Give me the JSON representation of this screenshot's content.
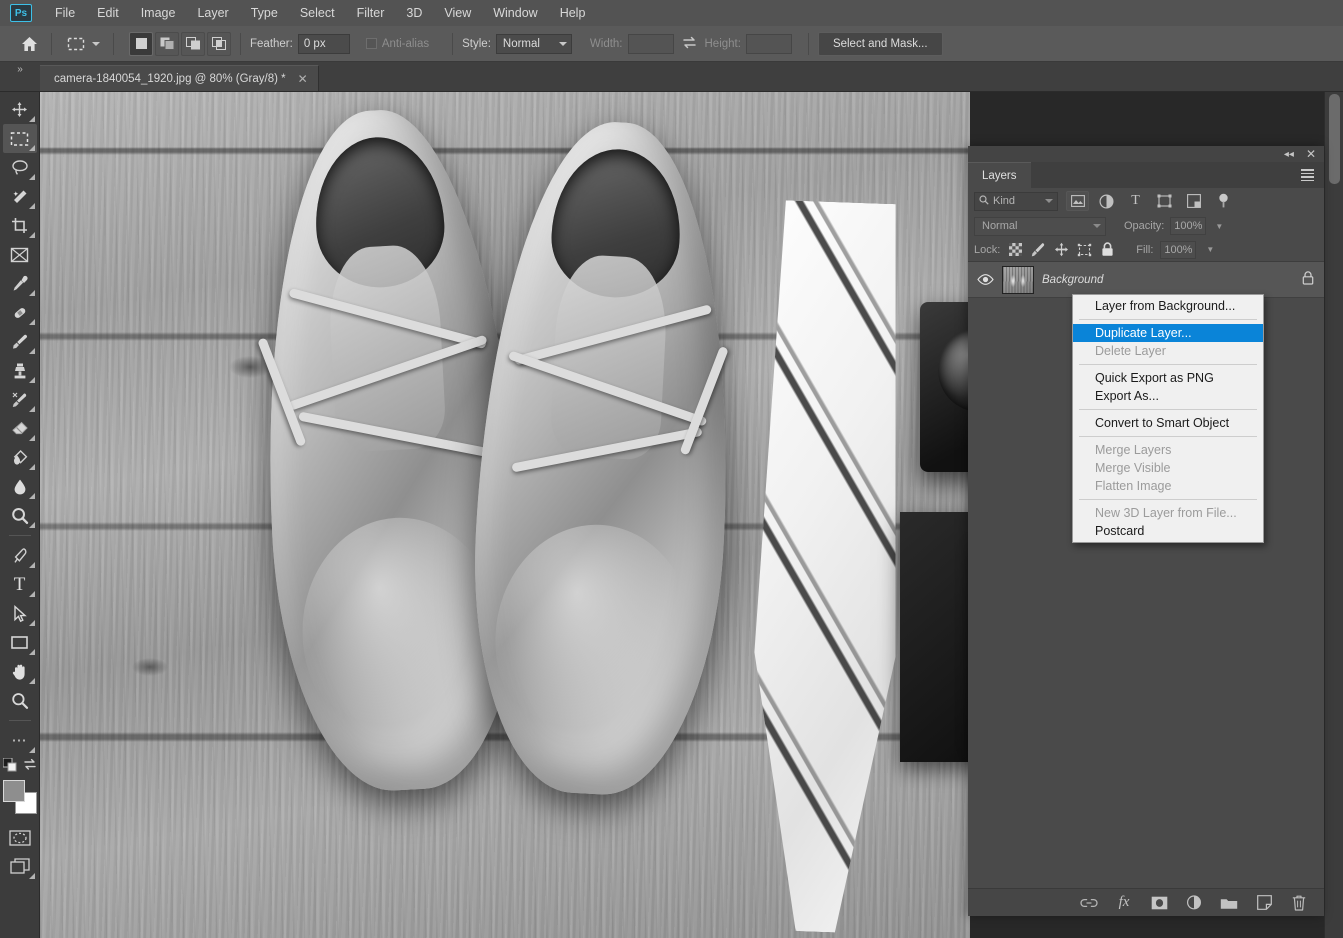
{
  "app": {
    "logo": "Ps"
  },
  "menubar": {
    "items": [
      "File",
      "Edit",
      "Image",
      "Layer",
      "Type",
      "Select",
      "Filter",
      "3D",
      "View",
      "Window",
      "Help"
    ]
  },
  "optionsbar": {
    "home_icon": "home-icon",
    "tool_preset_icon": "marquee-tool-icon",
    "selection_modes": [
      {
        "name": "new-selection",
        "active": true
      },
      {
        "name": "add-to-selection",
        "active": false
      },
      {
        "name": "subtract-from-selection",
        "active": false
      },
      {
        "name": "intersect-with-selection",
        "active": false
      }
    ],
    "feather_label": "Feather:",
    "feather_value": "0 px",
    "antialias_label": "Anti-alias",
    "antialias_checked": false,
    "style_label": "Style:",
    "style_value": "Normal",
    "width_label": "Width:",
    "width_value": "",
    "swap_icon": "swap-width-height-icon",
    "height_label": "Height:",
    "height_value": "",
    "select_and_mask_label": "Select and Mask..."
  },
  "tabbar": {
    "collapse_icon": "expand-panels-icon",
    "document_title": "camera-1840054_1920.jpg @ 80% (Gray/8) *",
    "close_icon": "close-icon"
  },
  "toolbar": {
    "tools": [
      {
        "name": "move-tool",
        "glyph": "✥",
        "active": false,
        "has_flyout": true
      },
      {
        "name": "rectangular-marquee-tool",
        "glyph": "",
        "active": true,
        "has_flyout": true
      },
      {
        "name": "lasso-tool",
        "glyph": "",
        "active": false,
        "has_flyout": true
      },
      {
        "name": "magic-wand-tool",
        "glyph": "",
        "active": false,
        "has_flyout": true
      },
      {
        "name": "crop-tool",
        "glyph": "",
        "active": false,
        "has_flyout": true
      },
      {
        "name": "frame-tool",
        "glyph": "",
        "active": false,
        "has_flyout": false
      },
      {
        "name": "eyedropper-tool",
        "glyph": "",
        "active": false,
        "has_flyout": true
      },
      {
        "name": "spot-healing-brush-tool",
        "glyph": "",
        "active": false,
        "has_flyout": true
      },
      {
        "name": "brush-tool",
        "glyph": "",
        "active": false,
        "has_flyout": true
      },
      {
        "name": "clone-stamp-tool",
        "glyph": "",
        "active": false,
        "has_flyout": true
      },
      {
        "name": "history-brush-tool",
        "glyph": "",
        "active": false,
        "has_flyout": true
      },
      {
        "name": "eraser-tool",
        "glyph": "",
        "active": false,
        "has_flyout": true
      },
      {
        "name": "gradient-tool",
        "glyph": "",
        "active": false,
        "has_flyout": true
      },
      {
        "name": "blur-tool",
        "glyph": "",
        "active": false,
        "has_flyout": true
      },
      {
        "name": "dodge-tool",
        "glyph": "",
        "active": false,
        "has_flyout": true
      },
      {
        "name": "pen-tool",
        "glyph": "",
        "active": false,
        "has_flyout": true
      },
      {
        "name": "horizontal-type-tool",
        "glyph": "T",
        "active": false,
        "has_flyout": true
      },
      {
        "name": "path-selection-tool",
        "glyph": "",
        "active": false,
        "has_flyout": true
      },
      {
        "name": "rectangle-tool",
        "glyph": "",
        "active": false,
        "has_flyout": true
      },
      {
        "name": "hand-tool",
        "glyph": "",
        "active": false,
        "has_flyout": true
      },
      {
        "name": "zoom-tool",
        "glyph": "",
        "active": false,
        "has_flyout": false
      },
      {
        "name": "edit-toolbar-button",
        "glyph": "⋯",
        "active": false,
        "has_flyout": true
      }
    ],
    "default_colors_icon": "default-colors-icon",
    "swap_colors_icon": "swap-colors-icon",
    "foreground_color": "#8e8e8e",
    "background_color": "#ffffff",
    "quick_mask_icon": "quick-mask-mode-icon",
    "screen_mode_icon": "screen-mode-icon"
  },
  "canvas": {
    "image_description": "Grayscale photo of a pair of brogue shoes, a striped necktie, a camera and a notebook on weathered wooden planks"
  },
  "layers_panel": {
    "collapse_icon": "collapse-panel-icon",
    "close_icon": "close-panel-icon",
    "tab_label": "Layers",
    "menu_icon": "panel-menu-icon",
    "filter": {
      "search_icon": "search-icon",
      "kind_label": "Kind",
      "icons": [
        "pixel-layers-filter-icon",
        "adjustment-layers-filter-icon",
        "type-layers-filter-icon",
        "shape-layers-filter-icon",
        "smart-object-filter-icon",
        "filter-toggle-icon"
      ]
    },
    "blend_mode": "Normal",
    "opacity_label": "Opacity:",
    "opacity_value": "100%",
    "lock_label": "Lock:",
    "lock_icons": [
      "lock-transparent-pixels-icon",
      "lock-image-pixels-icon",
      "lock-position-icon",
      "lock-artboard-nesting-icon",
      "lock-all-icon"
    ],
    "fill_label": "Fill:",
    "fill_value": "100%",
    "layers": [
      {
        "visibility_icon": "eye-icon",
        "thumbnail": "layer-thumbnail",
        "name": "Background",
        "lock_icon": "lock-icon",
        "selected": true
      }
    ],
    "footer_icons": [
      "link-layers-icon",
      "layer-style-fx-icon",
      "add-layer-mask-icon",
      "new-adjustment-layer-icon",
      "new-group-icon",
      "new-layer-icon",
      "delete-layer-icon"
    ]
  },
  "context_menu": {
    "items": [
      {
        "label": "Layer from Background...",
        "state": "normal"
      },
      {
        "separator": true
      },
      {
        "label": "Duplicate Layer...",
        "state": "selected"
      },
      {
        "label": "Delete Layer",
        "state": "disabled"
      },
      {
        "separator": true
      },
      {
        "label": "Quick Export as PNG",
        "state": "normal"
      },
      {
        "label": "Export As...",
        "state": "normal"
      },
      {
        "separator": true
      },
      {
        "label": "Convert to Smart Object",
        "state": "normal"
      },
      {
        "separator": true
      },
      {
        "label": "Merge Layers",
        "state": "disabled"
      },
      {
        "label": "Merge Visible",
        "state": "disabled"
      },
      {
        "label": "Flatten Image",
        "state": "disabled"
      },
      {
        "separator": true
      },
      {
        "label": "New 3D Layer from File...",
        "state": "disabled"
      },
      {
        "label": "Postcard",
        "state": "normal"
      }
    ]
  },
  "colors": {
    "menubar_bg": "#535353",
    "options_bg": "#5a5a5a",
    "panel_bg": "#4a4a4a",
    "canvas_bg": "#282828",
    "menu_bg": "#f0f0f0",
    "menu_highlight": "#0a84d8",
    "accent": "#3dc0e8"
  }
}
